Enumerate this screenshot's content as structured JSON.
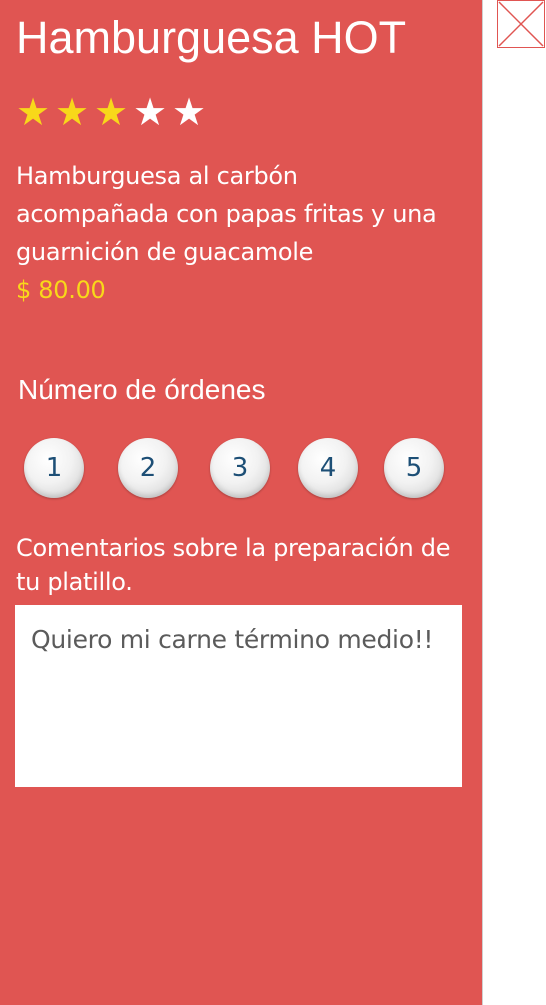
{
  "product": {
    "title": "Hamburguesa HOT",
    "rating": 3,
    "rating_max": 5,
    "star_icons": [
      "★",
      "★",
      "★",
      "★",
      "★"
    ],
    "description": "Hamburguesa al carbón acompañada con papas fritas y una guarnición de guacamole",
    "price": "$ 80.00"
  },
  "orders": {
    "label": "Número de órdenes",
    "options": [
      "1",
      "2",
      "3",
      "4",
      "5"
    ]
  },
  "comments": {
    "label": "Comentarios sobre la preparación de tu platillo.",
    "value": "Quiero mi carne término medio!!"
  },
  "colors": {
    "panel": "#e05552",
    "accent": "#f8d81a",
    "button_text": "#1d4f76"
  },
  "icons": {
    "close": "close-icon"
  }
}
